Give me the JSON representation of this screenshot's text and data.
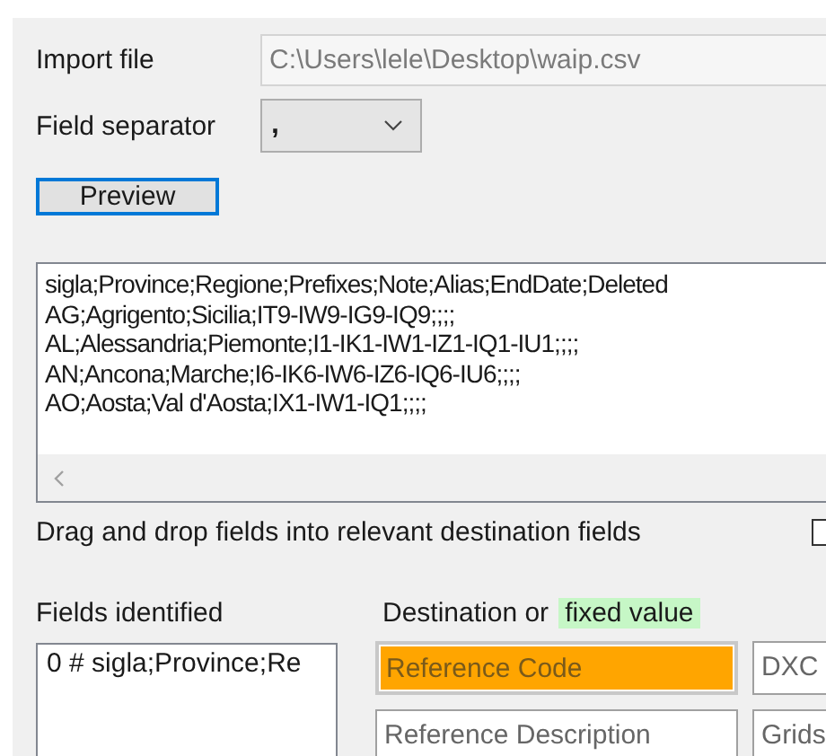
{
  "import_file": {
    "label": "Import file",
    "value": "C:\\Users\\lele\\Desktop\\waip.csv",
    "disabled": true
  },
  "field_separator": {
    "label": "Field separator",
    "value": ","
  },
  "preview_button": {
    "label": "Preview",
    "focused": true
  },
  "preview_lines": [
    "sigla;Province;Regione;Prefixes;Note;Alias;EndDate;Deleted",
    "AG;Agrigento;Sicilia;IT9-IW9-IG9-IQ9;;;;",
    "AL;Alessandria;Piemonte;I1-IK1-IW1-IZ1-IQ1-IU1;;;;",
    "AN;Ancona;Marche;I6-IK6-IW6-IZ6-IQ6-IU6;;;;",
    "AO;Aosta;Val d'Aosta;IX1-IW1-IQ1;;;;"
  ],
  "instruction": "Drag and drop fields into relevant destination fields",
  "option_checkbox": {
    "checked": false
  },
  "fields_identified": {
    "label": "Fields identified",
    "items": [
      "0 # sigla;Province;Re"
    ]
  },
  "destination": {
    "label": "Destination or",
    "fixed_value_label": "fixed value"
  },
  "destination_fields": [
    {
      "label": "Reference Code",
      "highlighted": true
    },
    {
      "label": "DXC",
      "highlighted": false
    },
    {
      "label": "Reference Description",
      "highlighted": false
    },
    {
      "label": "Grids",
      "highlighted": false
    }
  ]
}
